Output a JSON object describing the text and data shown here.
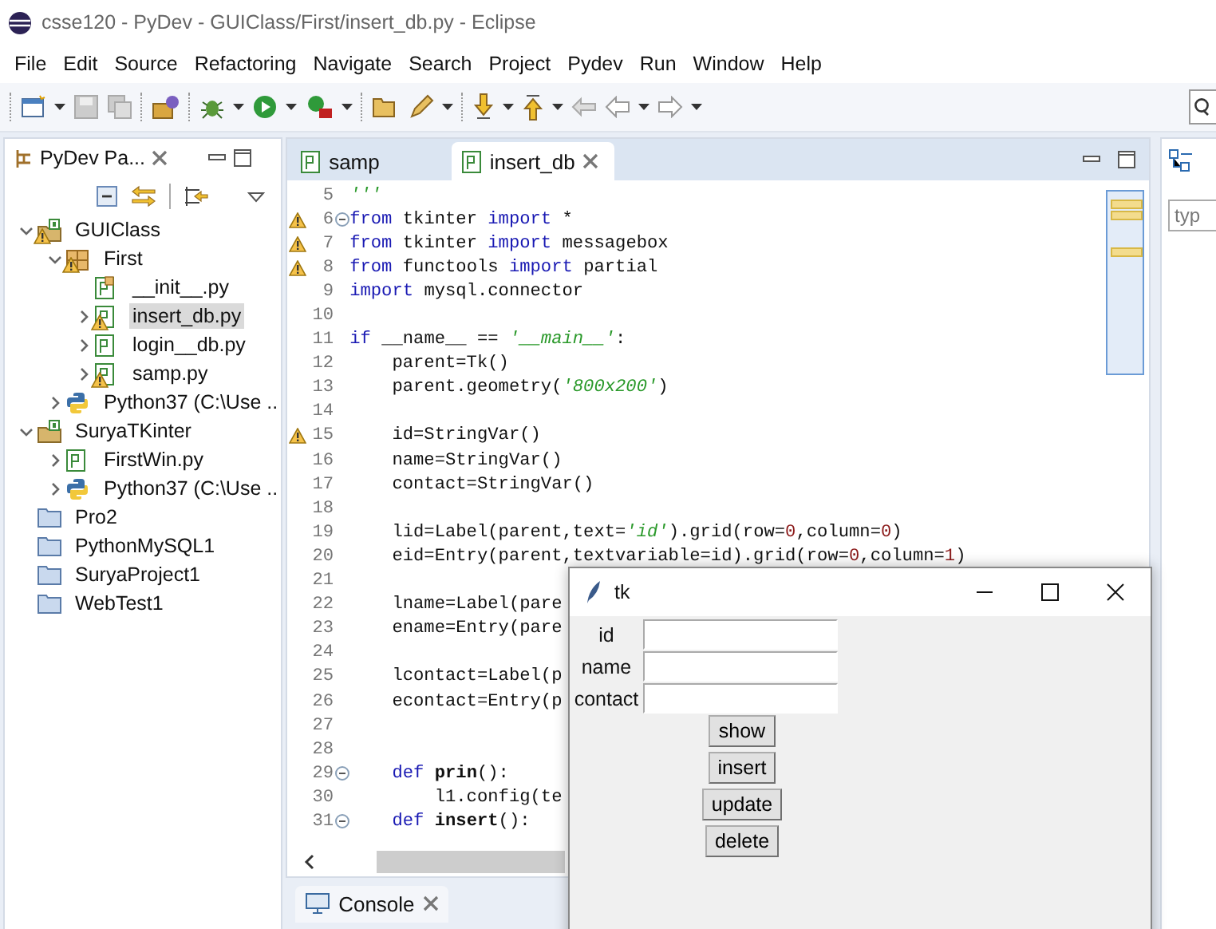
{
  "window": {
    "title": "csse120 - PyDev - GUIClass/First/insert_db.py - Eclipse"
  },
  "menu": [
    "File",
    "Edit",
    "Source",
    "Refactoring",
    "Navigate",
    "Search",
    "Project",
    "Pydev",
    "Run",
    "Window",
    "Help"
  ],
  "explorer": {
    "title": "PyDev Pa...",
    "tree": [
      {
        "label": "GUIClass",
        "kind": "project",
        "expanded": true,
        "warning": true,
        "selected": false,
        "children": [
          {
            "label": "First",
            "kind": "package",
            "expanded": true,
            "warning": true,
            "selected": false,
            "children": [
              {
                "label": "__init__.py",
                "kind": "pyinit",
                "warning": false,
                "selected": false
              },
              {
                "label": "insert_db.py",
                "kind": "pyfile",
                "expanded": false,
                "warning": true,
                "selected": true
              },
              {
                "label": "login__db.py",
                "kind": "pyfile",
                "expanded": false,
                "warning": false,
                "selected": false
              },
              {
                "label": "samp.py",
                "kind": "pyfile",
                "expanded": false,
                "warning": true,
                "selected": false
              }
            ]
          },
          {
            "label": "Python37  (C:\\Use ..",
            "kind": "interpreter",
            "expanded": false,
            "warning": false,
            "selected": false
          }
        ]
      },
      {
        "label": "SuryaTKinter",
        "kind": "project",
        "expanded": true,
        "warning": false,
        "selected": false,
        "children": [
          {
            "label": "FirstWin.py",
            "kind": "pyfile",
            "expanded": false,
            "warning": false,
            "selected": false
          },
          {
            "label": "Python37  (C:\\Use ..",
            "kind": "interpreter",
            "expanded": false,
            "warning": false,
            "selected": false
          }
        ]
      },
      {
        "label": "Pro2",
        "kind": "folder",
        "warning": false,
        "selected": false
      },
      {
        "label": "PythonMySQL1",
        "kind": "folder",
        "warning": false,
        "selected": false
      },
      {
        "label": "SuryaProject1",
        "kind": "folder",
        "warning": false,
        "selected": false
      },
      {
        "label": "WebTest1",
        "kind": "folder",
        "warning": false,
        "selected": false
      }
    ]
  },
  "editor_tabs": [
    {
      "label": "samp",
      "selected": false
    },
    {
      "label": "insert_db",
      "selected": true
    }
  ],
  "lines": [
    {
      "n": "5",
      "warning": false,
      "fold": false,
      "tokens": [
        {
          "kind": "str",
          "t": "'''"
        }
      ]
    },
    {
      "n": "6",
      "warning": true,
      "fold": true,
      "tokens": [
        {
          "kind": "kw",
          "t": "from"
        },
        {
          "kind": "plain",
          "t": " tkinter "
        },
        {
          "kind": "kw",
          "t": "import"
        },
        {
          "kind": "plain",
          "t": " *"
        }
      ]
    },
    {
      "n": "7",
      "warning": true,
      "fold": false,
      "tokens": [
        {
          "kind": "kw",
          "t": "from"
        },
        {
          "kind": "plain",
          "t": " tkinter "
        },
        {
          "kind": "kw",
          "t": "import"
        },
        {
          "kind": "plain",
          "t": " messagebox"
        }
      ]
    },
    {
      "n": "8",
      "warning": true,
      "fold": false,
      "tokens": [
        {
          "kind": "kw",
          "t": "from"
        },
        {
          "kind": "plain",
          "t": " functools "
        },
        {
          "kind": "kw",
          "t": "import"
        },
        {
          "kind": "plain",
          "t": " partial"
        }
      ]
    },
    {
      "n": "9",
      "warning": false,
      "fold": false,
      "tokens": [
        {
          "kind": "kw",
          "t": "import"
        },
        {
          "kind": "plain",
          "t": " mysql.connector"
        }
      ]
    },
    {
      "n": "10",
      "warning": false,
      "fold": false
    },
    {
      "n": "11",
      "warning": false,
      "fold": false,
      "tokens": [
        {
          "kind": "kw",
          "t": "if"
        },
        {
          "kind": "plain",
          "t": " __name__ == "
        },
        {
          "kind": "str",
          "t": "'__main__'"
        },
        {
          "kind": "plain",
          "t": ":"
        }
      ]
    },
    {
      "n": "12",
      "warning": false,
      "fold": false,
      "tokens": [
        {
          "kind": "plain",
          "t": "    parent=Tk()"
        }
      ]
    },
    {
      "n": "13",
      "warning": false,
      "fold": false,
      "tokens": [
        {
          "kind": "plain",
          "t": "    parent.geometry("
        },
        {
          "kind": "str",
          "t": "'800x200'"
        },
        {
          "kind": "plain",
          "t": ")"
        }
      ]
    },
    {
      "n": "14",
      "warning": false,
      "fold": false
    },
    {
      "n": "15",
      "warning": true,
      "fold": false,
      "tokens": [
        {
          "kind": "plain",
          "t": "    id=StringVar()"
        }
      ]
    },
    {
      "n": "16",
      "warning": false,
      "fold": false,
      "tokens": [
        {
          "kind": "plain",
          "t": "    name=StringVar()"
        }
      ]
    },
    {
      "n": "17",
      "warning": false,
      "fold": false,
      "tokens": [
        {
          "kind": "plain",
          "t": "    contact=StringVar()"
        }
      ]
    },
    {
      "n": "18",
      "warning": false,
      "fold": false
    },
    {
      "n": "19",
      "warning": false,
      "fold": false,
      "tokens": [
        {
          "kind": "plain",
          "t": "    lid=Label(parent,text="
        },
        {
          "kind": "str",
          "t": "'id'"
        },
        {
          "kind": "plain",
          "t": ").grid(row="
        },
        {
          "kind": "num",
          "t": "0"
        },
        {
          "kind": "plain",
          "t": ",column="
        },
        {
          "kind": "num",
          "t": "0"
        },
        {
          "kind": "plain",
          "t": ")"
        }
      ]
    },
    {
      "n": "20",
      "warning": false,
      "fold": false,
      "tokens": [
        {
          "kind": "plain",
          "t": "    eid=Entry(parent,textvariable=id).grid(row="
        },
        {
          "kind": "num",
          "t": "0"
        },
        {
          "kind": "plain",
          "t": ",column="
        },
        {
          "kind": "num",
          "t": "1"
        },
        {
          "kind": "plain",
          "t": ")"
        }
      ]
    },
    {
      "n": "21",
      "warning": false,
      "fold": false
    },
    {
      "n": "22",
      "warning": false,
      "fold": false,
      "tokens": [
        {
          "kind": "plain",
          "t": "    lname=Label(pare"
        }
      ]
    },
    {
      "n": "23",
      "warning": false,
      "fold": false,
      "tokens": [
        {
          "kind": "plain",
          "t": "    ename=Entry(pare"
        }
      ]
    },
    {
      "n": "24",
      "warning": false,
      "fold": false
    },
    {
      "n": "25",
      "warning": false,
      "fold": false,
      "tokens": [
        {
          "kind": "plain",
          "t": "    lcontact=Label(p"
        }
      ]
    },
    {
      "n": "26",
      "warning": false,
      "fold": false,
      "tokens": [
        {
          "kind": "plain",
          "t": "    econtact=Entry(p"
        }
      ]
    },
    {
      "n": "27",
      "warning": false,
      "fold": false
    },
    {
      "n": "28",
      "warning": false,
      "fold": false
    },
    {
      "n": "29",
      "warning": false,
      "fold": true,
      "tokens": [
        {
          "kind": "kw",
          "t": "    def"
        },
        {
          "kind": "def",
          "t": " prin"
        },
        {
          "kind": "plain",
          "t": "():"
        }
      ]
    },
    {
      "n": "30",
      "warning": false,
      "fold": false,
      "tokens": [
        {
          "kind": "plain",
          "t": "        l1.config(te"
        }
      ]
    },
    {
      "n": "31",
      "warning": false,
      "fold": true,
      "tokens": [
        {
          "kind": "kw",
          "t": "    def"
        },
        {
          "kind": "def",
          "t": " insert"
        },
        {
          "kind": "plain",
          "t": "():"
        }
      ]
    }
  ],
  "outline": {
    "filter_placeholder": "typ"
  },
  "console": {
    "title": "Console"
  },
  "tk_window": {
    "title": "tk",
    "fields": [
      {
        "label": "id"
      },
      {
        "label": "name"
      },
      {
        "label": "contact"
      }
    ],
    "buttons": [
      "show",
      "insert",
      "update",
      "delete"
    ]
  }
}
